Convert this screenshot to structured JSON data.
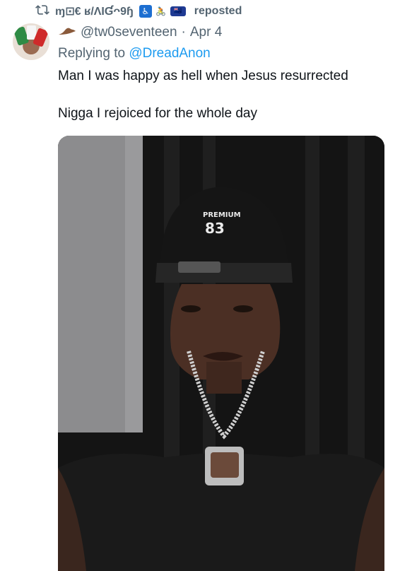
{
  "repost": {
    "display_name": "ɱ⊡€ ʁ/ɅƖƓᴖ9ɧ",
    "badges": [
      "♿",
      "🚴",
      "🇳🇿"
    ],
    "label": "reposted"
  },
  "tweet": {
    "handle": "@tw0seventeen",
    "separator": " · ",
    "date": "Apr 4",
    "replying_prefix": "Replying to ",
    "replying_to": "@DreadAnon",
    "lines": [
      "Man I was happy as hell when Jesus resurrected",
      "Nigga I rejoiced for the whole day"
    ]
  },
  "colors": {
    "muted": "#536471",
    "link": "#1d9bf0",
    "text": "#0f1419"
  }
}
